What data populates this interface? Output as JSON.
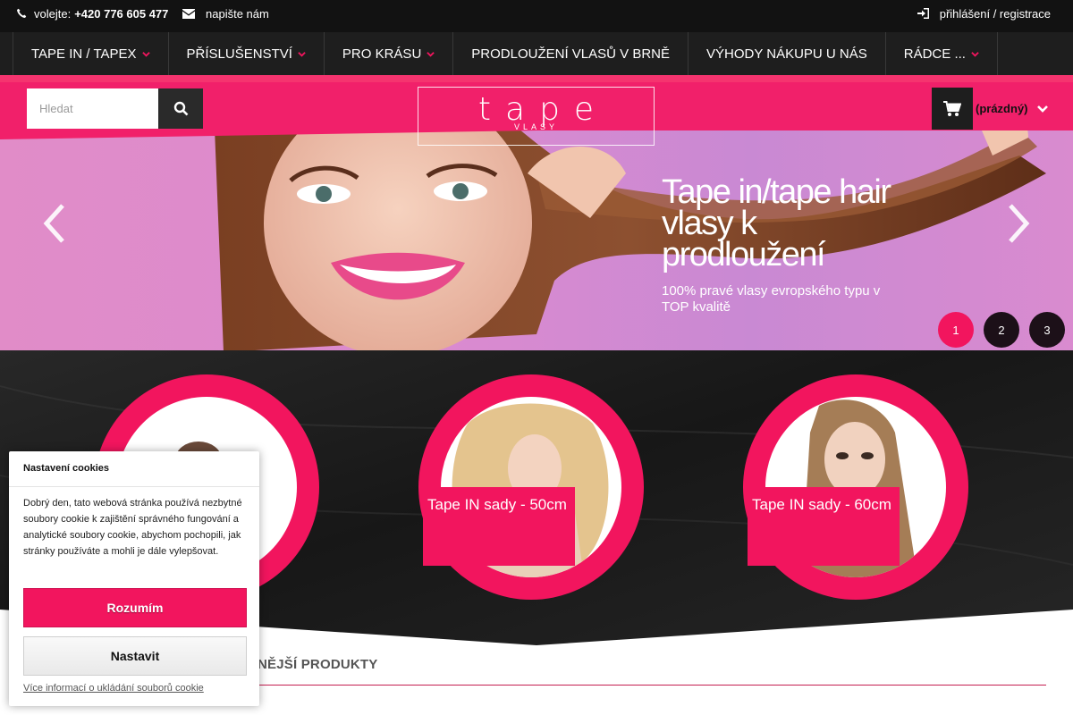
{
  "topbar": {
    "phone_prefix": "volejte:",
    "phone_number": "+420 776 605 477",
    "mail_label": "napište nám",
    "login_label": "přihlášení / registrace"
  },
  "nav": {
    "items": [
      {
        "label": "TAPE IN / TAPEX",
        "dropdown": true
      },
      {
        "label": "PŘÍSLUŠENSTVÍ",
        "dropdown": true
      },
      {
        "label": "PRO KRÁSU",
        "dropdown": true
      },
      {
        "label": "PRODLOUŽENÍ VLASŮ V BRNĚ",
        "dropdown": false
      },
      {
        "label": "VÝHODY NÁKUPU U NÁS",
        "dropdown": false
      },
      {
        "label": "RÁDCE ...",
        "dropdown": true
      }
    ]
  },
  "search": {
    "placeholder": "Hledat",
    "icon": "search-icon"
  },
  "logo": {
    "word": "tape",
    "sub": "VLASY"
  },
  "cart": {
    "label": "(prázdný)",
    "icon": "cart-icon"
  },
  "slider": {
    "title": "Tape in/tape hair vlasy k prodloužení",
    "subtitle": "100% pravé vlasy evropského typu v TOP kvalitě",
    "dots": [
      "1",
      "2",
      "3"
    ],
    "active": 0
  },
  "categories": [
    {
      "label": ""
    },
    {
      "label": "Tape IN sady - 50cm"
    },
    {
      "label": "Tape IN sady - 60cm"
    }
  ],
  "products": {
    "title": "NĚJŠÍ PRODUKTY"
  },
  "cookie": {
    "title": "Nastavení cookies",
    "text": "Dobrý den, tato webová stránka používá nezbytné soubory cookie k zajištění správného fungování a analytické soubory cookie, abychom pochopili, jak stránky používáte a mohli je dále vylepšovat.",
    "accept_label": "Rozumím",
    "settings_label": "Nastavit",
    "more_link": "Více informací o ukládání souborů cookie"
  },
  "colors": {
    "accent": "#f2155e",
    "dark": "#1e1e1e",
    "topbar": "#121212"
  }
}
